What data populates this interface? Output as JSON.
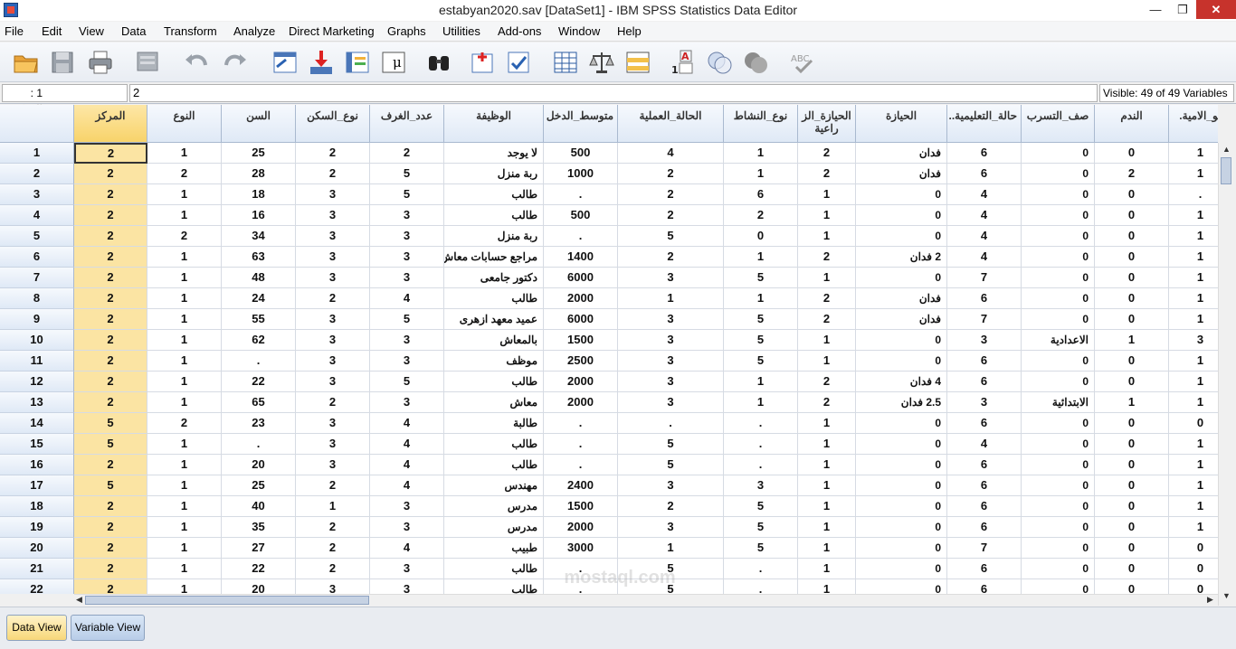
{
  "window": {
    "title": "estabyan2020.sav [DataSet1] - IBM SPSS Statistics Data Editor",
    "minimize": "—",
    "maximize": "❐",
    "close": "✕"
  },
  "menu": [
    "File",
    "Edit",
    "View",
    "Data",
    "Transform",
    "Analyze",
    "Direct Marketing",
    "Graphs",
    "Utilities",
    "Add-ons",
    "Window",
    "Help"
  ],
  "toolbar": {
    "icons": [
      "open-folder-icon",
      "save-icon",
      "print-icon",
      "dialog-recall-icon",
      "undo-icon",
      "redo-icon",
      "go-to-case-icon",
      "go-to-variable-icon",
      "variables-icon",
      "find-icon",
      "insert-cases-icon",
      "insert-variable-icon",
      "split-file-icon",
      "weight-cases-icon",
      "select-cases-icon",
      "value-labels-icon",
      "use-variable-sets-icon",
      "show-all-variables-icon",
      "spell-check-icon"
    ]
  },
  "cellbar": {
    "reference": "1 : المركز",
    "value": "2",
    "visible": "Visible: 49 of 49 Variables"
  },
  "columns": [
    "المركز",
    "النوع",
    "السن",
    "نوع_السكن",
    "عدد_الغرف",
    "الوظيفة",
    "متوسط_الدخل",
    "الحالة_العملية",
    "نوع_النشاط",
    "الحيازة_الز راعية",
    "الحيازة",
    "حالة_التعليمية..",
    "صف_التسرب",
    "الندم",
    "ـو_الامية."
  ],
  "rows": [
    [
      "2",
      "1",
      "25",
      "2",
      "2",
      "لا يوجد",
      "500",
      "4",
      "1",
      "2",
      "فدان",
      "6",
      "0",
      "0",
      "1"
    ],
    [
      "2",
      "2",
      "28",
      "2",
      "5",
      "ربة منزل",
      "1000",
      "2",
      "1",
      "2",
      "فدان",
      "6",
      "0",
      "2",
      "1"
    ],
    [
      "2",
      "1",
      "18",
      "3",
      "5",
      "طالب",
      ".",
      "2",
      "6",
      "1",
      "0",
      "4",
      "0",
      "0",
      "."
    ],
    [
      "2",
      "1",
      "16",
      "3",
      "3",
      "طالب",
      "500",
      "2",
      "2",
      "1",
      "0",
      "4",
      "0",
      "0",
      "1"
    ],
    [
      "2",
      "2",
      "34",
      "3",
      "3",
      "ربة منزل",
      ".",
      "5",
      "0",
      "1",
      "0",
      "4",
      "0",
      "0",
      "1"
    ],
    [
      "2",
      "1",
      "63",
      "3",
      "3",
      "مراجع حسابات معاش..",
      "1400",
      "2",
      "1",
      "2",
      "2 فدان",
      "4",
      "0",
      "0",
      "1"
    ],
    [
      "2",
      "1",
      "48",
      "3",
      "3",
      "دكتور جامعى",
      "6000",
      "3",
      "5",
      "1",
      "0",
      "7",
      "0",
      "0",
      "1"
    ],
    [
      "2",
      "1",
      "24",
      "2",
      "4",
      "طالب",
      "2000",
      "1",
      "1",
      "2",
      "فدان",
      "6",
      "0",
      "0",
      "1"
    ],
    [
      "2",
      "1",
      "55",
      "3",
      "5",
      "عميد معهد ازهرى",
      "6000",
      "3",
      "5",
      "2",
      "فدان",
      "7",
      "0",
      "0",
      "1"
    ],
    [
      "2",
      "1",
      "62",
      "3",
      "3",
      "بالمعاش",
      "1500",
      "3",
      "5",
      "1",
      "0",
      "3",
      "الاعدادية",
      "1",
      "3"
    ],
    [
      "2",
      "1",
      ".",
      "3",
      "3",
      "موظف",
      "2500",
      "3",
      "5",
      "1",
      "0",
      "6",
      "0",
      "0",
      "1"
    ],
    [
      "2",
      "1",
      "22",
      "3",
      "5",
      "طالب",
      "2000",
      "3",
      "1",
      "2",
      "4 فدان",
      "6",
      "0",
      "0",
      "1"
    ],
    [
      "2",
      "1",
      "65",
      "2",
      "3",
      "معاش",
      "2000",
      "3",
      "1",
      "2",
      "2.5 فدان",
      "3",
      "الابتدائية",
      "1",
      "1"
    ],
    [
      "5",
      "2",
      "23",
      "3",
      "4",
      "طالبة",
      ".",
      ".",
      ".",
      "1",
      "0",
      "6",
      "0",
      "0",
      "0"
    ],
    [
      "5",
      "1",
      ".",
      "3",
      "4",
      "طالب",
      ".",
      "5",
      ".",
      "1",
      "0",
      "4",
      "0",
      "0",
      "1"
    ],
    [
      "2",
      "1",
      "20",
      "3",
      "4",
      "طالب",
      ".",
      "5",
      ".",
      "1",
      "0",
      "6",
      "0",
      "0",
      "1"
    ],
    [
      "5",
      "1",
      "25",
      "2",
      "4",
      "مهندس",
      "2400",
      "3",
      "3",
      "1",
      "0",
      "6",
      "0",
      "0",
      "1"
    ],
    [
      "2",
      "1",
      "40",
      "1",
      "3",
      "مدرس",
      "1500",
      "2",
      "5",
      "1",
      "0",
      "6",
      "0",
      "0",
      "1"
    ],
    [
      "2",
      "1",
      "35",
      "2",
      "3",
      "مدرس",
      "2000",
      "3",
      "5",
      "1",
      "0",
      "6",
      "0",
      "0",
      "1"
    ],
    [
      "2",
      "1",
      "27",
      "2",
      "4",
      "طبيب",
      "3000",
      "1",
      "5",
      "1",
      "0",
      "7",
      "0",
      "0",
      "0"
    ],
    [
      "2",
      "1",
      "22",
      "2",
      "3",
      "طالب",
      ".",
      "5",
      ".",
      "1",
      "0",
      "6",
      "0",
      "0",
      "0"
    ],
    [
      "2",
      "1",
      "20",
      "3",
      "3",
      "طالب",
      ".",
      "5",
      ".",
      "1",
      "0",
      "6",
      "0",
      "0",
      "0"
    ]
  ],
  "tabs": {
    "data_view": "Data View",
    "variable_view": "Variable View"
  },
  "watermark": "mostaql.com"
}
